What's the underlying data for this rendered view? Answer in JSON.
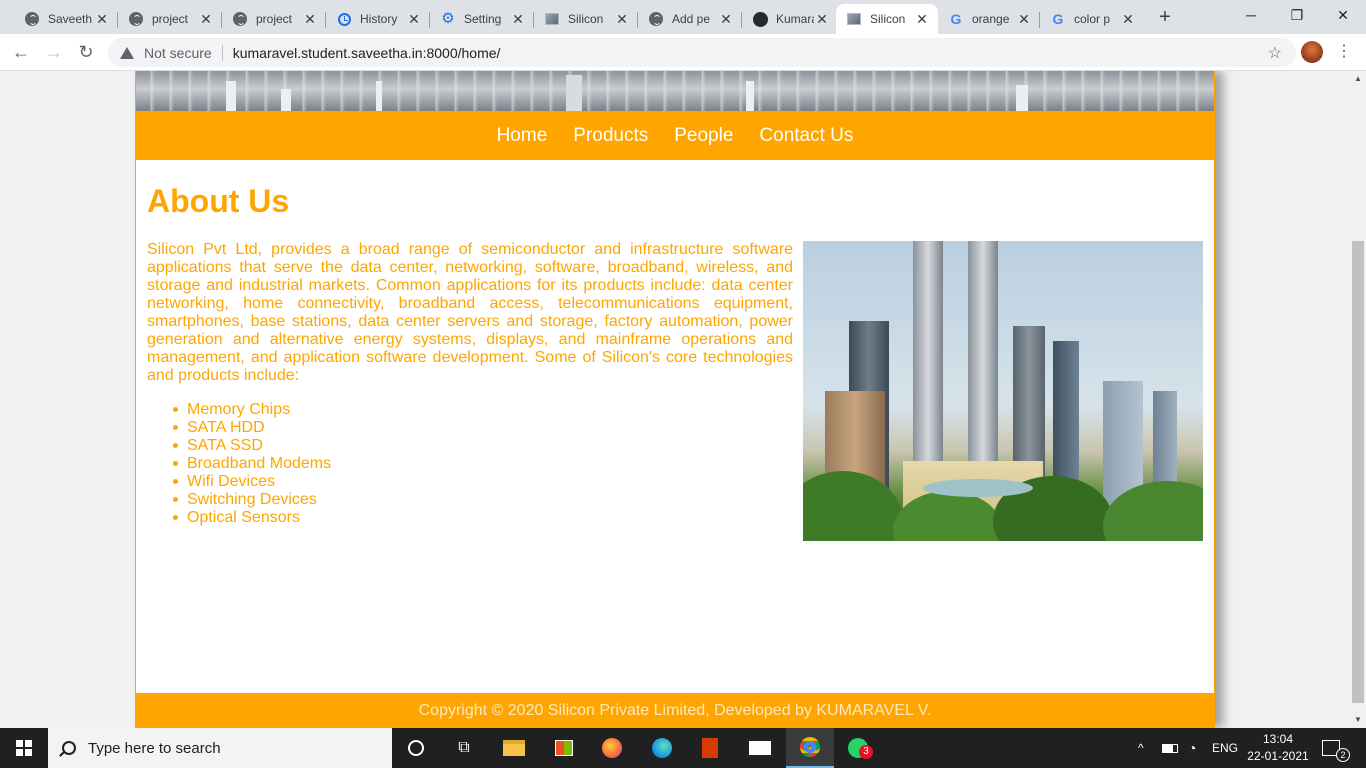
{
  "browser": {
    "tabs": [
      {
        "label": "Saveeth",
        "icon": "globe-icon"
      },
      {
        "label": "project",
        "icon": "globe-icon"
      },
      {
        "label": "project",
        "icon": "globe-icon"
      },
      {
        "label": "History",
        "icon": "history-icon"
      },
      {
        "label": "Setting",
        "icon": "settings-gear-icon"
      },
      {
        "label": "Silicon",
        "icon": "site-thumbnail-icon"
      },
      {
        "label": "Add pe",
        "icon": "globe-icon"
      },
      {
        "label": "Kumara",
        "icon": "github-icon"
      },
      {
        "label": "Silicon",
        "icon": "site-thumbnail-icon",
        "active": true
      },
      {
        "label": "orange",
        "icon": "google-icon"
      },
      {
        "label": "color p",
        "icon": "google-icon"
      }
    ],
    "new_tab": "+",
    "security_label": "Not secure",
    "url": "kumaravel.student.saveetha.in:8000/home/"
  },
  "site": {
    "nav": [
      "Home",
      "Products",
      "People",
      "Contact Us"
    ],
    "heading": "About Us",
    "paragraph": "Silicon Pvt Ltd, provides a broad range of semiconductor and infrastructure software applications that serve the data center, networking, software, broadband, wireless, and storage and industrial markets. Common applications for its products include: data center networking, home connectivity, broadband access, telecommunications equipment, smartphones, base stations, data center servers and storage, factory automation, power generation and alternative energy systems, displays, and mainframe operations and management, and application software development. Some of Silicon's core technologies and products include:",
    "products": [
      "Memory Chips",
      "SATA HDD",
      "SATA SSD",
      "Broadband Modems",
      "Wifi Devices",
      "Switching Devices",
      "Optical Sensors"
    ],
    "footer": "Copyright © 2020 Silicon Private Limited, Developed by KUMARAVEL V.",
    "colors": {
      "accent": "#ffa500",
      "footer_text": "#ffe8c0"
    }
  },
  "taskbar": {
    "search_placeholder": "Type here to search",
    "language": "ENG",
    "time": "13:04",
    "date": "22-01-2021",
    "whatsapp_badge": "3",
    "notification_count": "2"
  }
}
